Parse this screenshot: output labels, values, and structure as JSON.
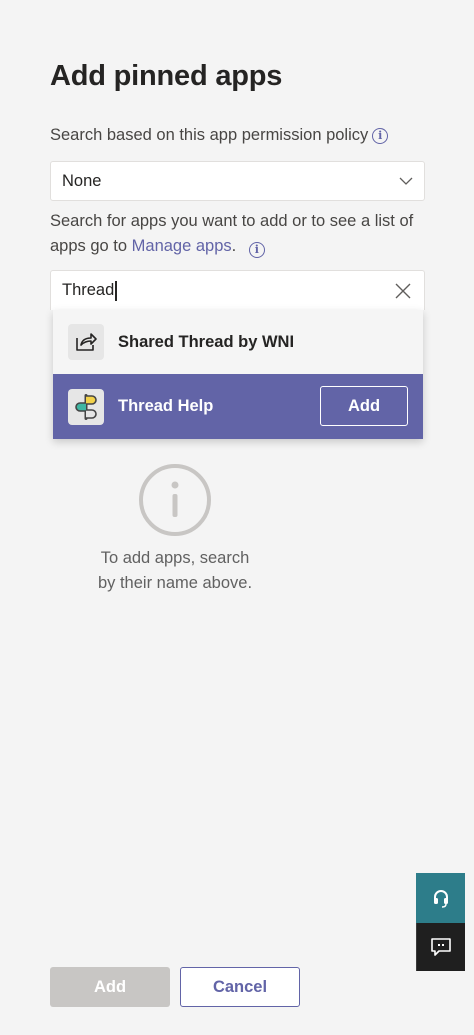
{
  "page": {
    "title": "Add pinned apps"
  },
  "policy": {
    "label": "Search based on this app permission policy",
    "info_icon": "info-icon",
    "selected": "None"
  },
  "search": {
    "help_text": "Search for apps you want to add or to see a list of apps go to",
    "link_text": "Manage apps",
    "help_suffix": ".",
    "value": "Thread"
  },
  "results": [
    {
      "name": "Shared Thread by WNI",
      "icon": "share-arrow-icon"
    },
    {
      "name": "Thread Help",
      "icon": "thread-help-logo-icon",
      "add_label": "Add",
      "selected": true
    }
  ],
  "empty_state": {
    "icon": "info-circle-icon",
    "text": "To add apps, search by their name above."
  },
  "footer": {
    "add_label": "Add",
    "cancel_label": "Cancel"
  },
  "side_buttons": {
    "help": "headset-icon",
    "feedback": "feedback-icon"
  },
  "colors": {
    "accent": "#6264a7",
    "help_bg": "#2d7d8a",
    "feedback_bg": "#1f1f1f"
  }
}
